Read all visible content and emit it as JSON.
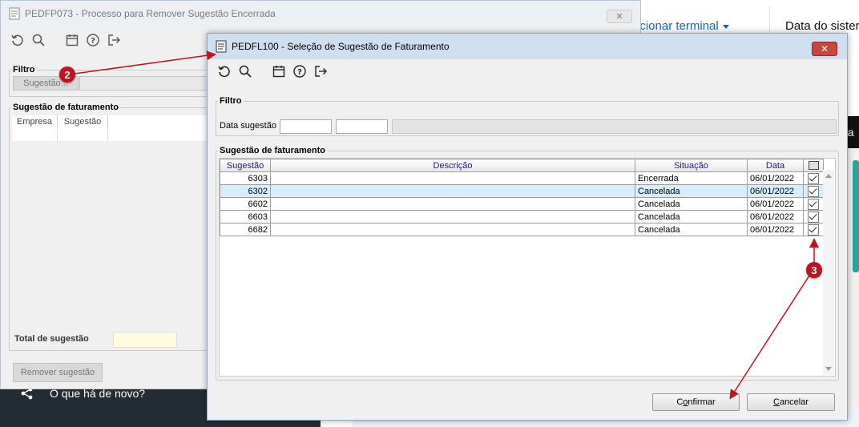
{
  "background_page": {
    "nav_link": "ecionar terminal",
    "date_label": "Data do sister",
    "dark_strip_text": "da",
    "whats_new": "O que há de novo?"
  },
  "back_window": {
    "title": "PEDFP073 - Processo para Remover Sugestão Encerrada",
    "close_label": "✕",
    "filter_legend": "Filtro",
    "sugestao_button": "Sugestão...",
    "grid_legend": "Sugestão de faturamento",
    "grid_columns": [
      "Empresa",
      "Sugestão"
    ],
    "total_label": "Total de sugestão",
    "remove_button": "Remover sugestão"
  },
  "front_window": {
    "title": "PEDFL100 - Seleção de Sugestão de Faturamento",
    "close_label": "✕",
    "filter_legend": "Filtro",
    "data_sugestao_label": "Data sugestão",
    "date_from_value": "",
    "date_to_value": "",
    "grid_legend": "Sugestão de faturamento",
    "columns": [
      "Sugestão",
      "Descrição",
      "Situação",
      "Data"
    ],
    "rows": [
      {
        "sugestao": "6303",
        "descricao": "",
        "situacao": "Encerrada",
        "data": "06/01/2022",
        "checked": true
      },
      {
        "sugestao": "6302",
        "descricao": "",
        "situacao": "Cancelada",
        "data": "06/01/2022",
        "checked": true
      },
      {
        "sugestao": "6602",
        "descricao": "",
        "situacao": "Cancelada",
        "data": "06/01/2022",
        "checked": true
      },
      {
        "sugestao": "6603",
        "descricao": "",
        "situacao": "Cancelada",
        "data": "06/01/2022",
        "checked": true
      },
      {
        "sugestao": "6682",
        "descricao": "",
        "situacao": "Cancelada",
        "data": "06/01/2022",
        "checked": true
      }
    ],
    "selected_row": 1,
    "confirm_button_pre": "C",
    "confirm_button_accel": "o",
    "confirm_button_post": "nfirmar",
    "cancel_button_accel": "C",
    "cancel_button_post": "ancelar"
  },
  "annotations": {
    "badge_2": "2",
    "badge_3": "3",
    "color": "#c1121f"
  },
  "toolbar_icons": [
    "refresh-icon",
    "search-icon",
    "calendar-icon",
    "help-icon",
    "exit-icon"
  ]
}
